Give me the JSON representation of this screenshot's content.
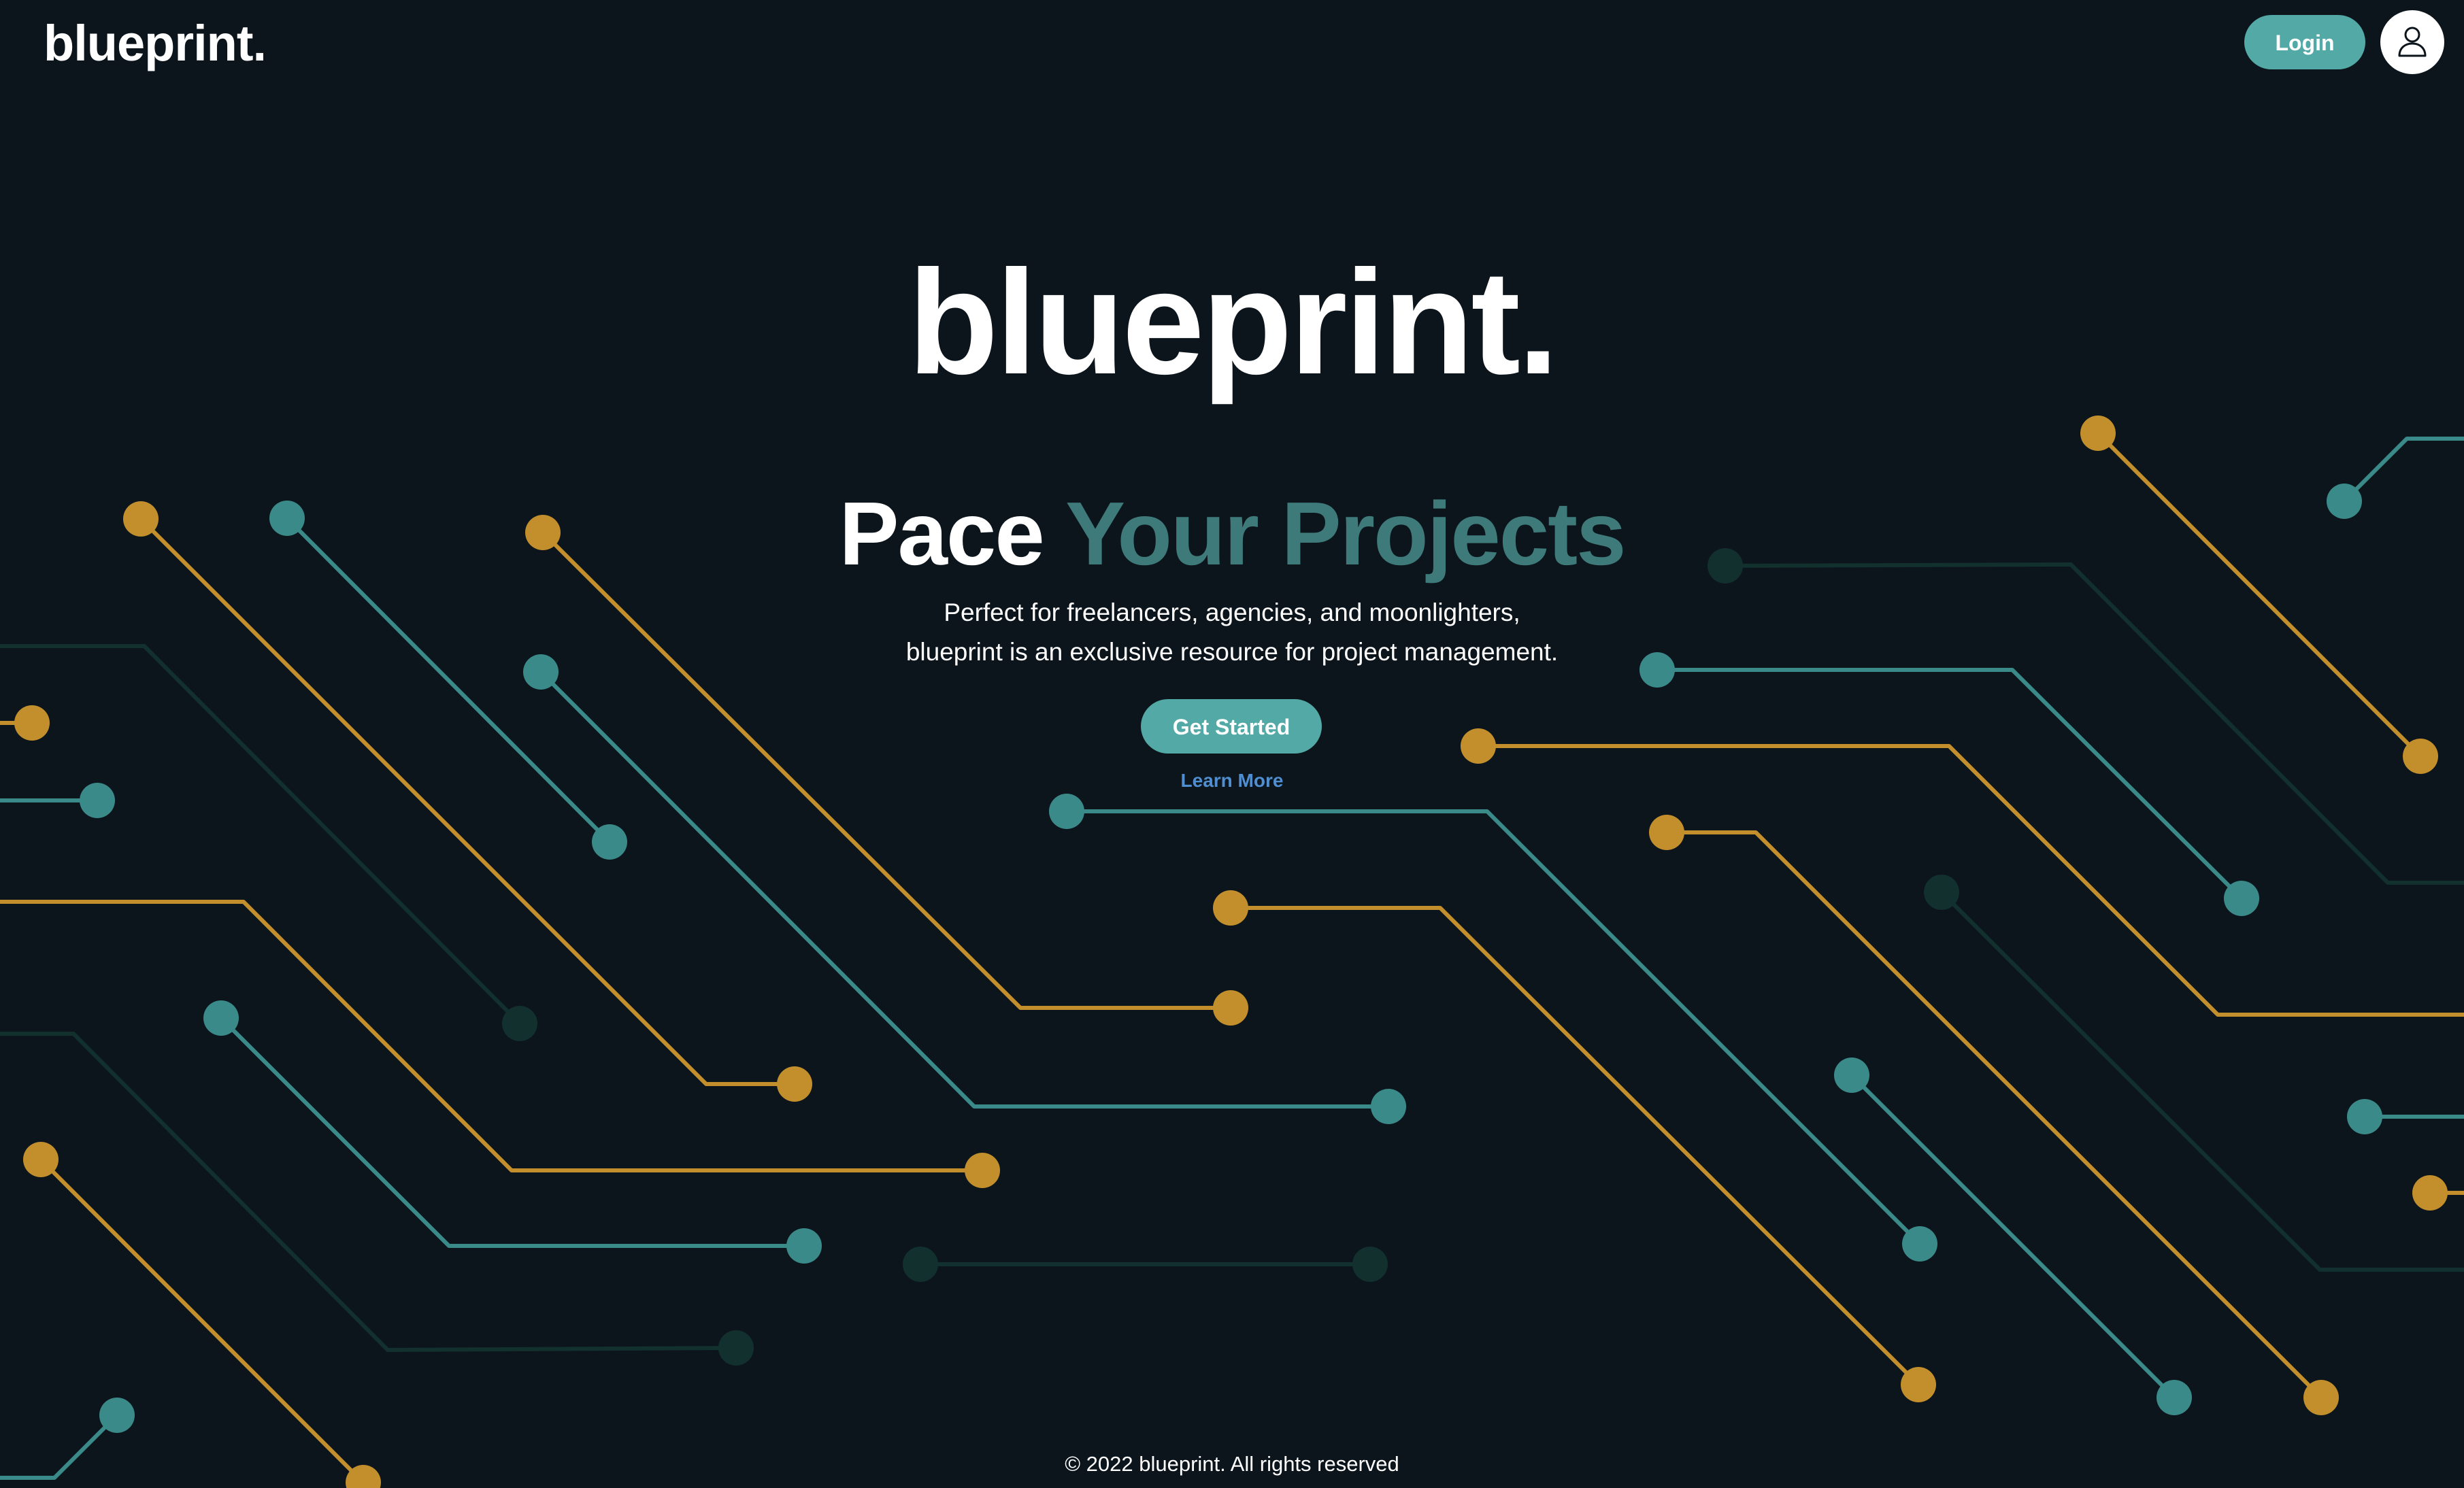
{
  "nav": {
    "logo": "blueprint.",
    "login_label": "Login",
    "user_icon": "user-icon"
  },
  "hero": {
    "title": "blueprint.",
    "tagline_plain": "Pace",
    "tagline_accent": "Your Projects",
    "desc_line1": "Perfect for freelancers, agencies, and moonlighters,",
    "desc_line2": "blueprint is an exclusive resource for project management.",
    "cta_label": "Get Started",
    "learn_more_label": "Learn More"
  },
  "footer": {
    "text": "© 2022 blueprint. All rights reserved"
  },
  "colors": {
    "background": "#0c151c",
    "accent_teal": "#52a9a6",
    "teal_line": "#3b8a8a",
    "gold_line": "#c28f2c",
    "dim_line": "#12302e",
    "tagline_accent": "#3f7a7a",
    "link_blue": "#4f8fd1"
  },
  "decoration": {
    "background_pattern": "circuit-traces"
  }
}
